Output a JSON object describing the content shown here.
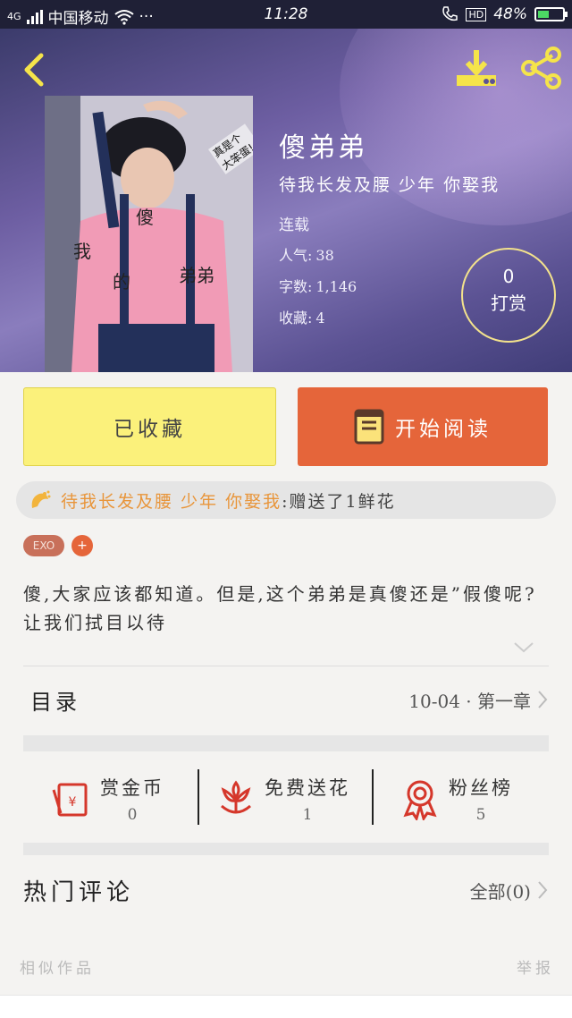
{
  "status_bar": {
    "network": "4G",
    "carrier": "中国移动",
    "dots": "···",
    "time": "11:28",
    "hd": "HD",
    "battery_text": "48%",
    "battery_level": 0.48,
    "battery_color": "#4cd964"
  },
  "header": {
    "back_icon": "chevron-left-icon",
    "download_icon": "download-icon",
    "share_icon": "share-icon",
    "icon_color": "#f5e44a"
  },
  "cover": {
    "text_1": "傻",
    "text_2": "我",
    "text_3": "的",
    "text_4": "弟弟",
    "note": "真是个大笨蛋!"
  },
  "book": {
    "title": "傻弟弟",
    "author": "待我长发及腰 少年 你娶我",
    "status": "连载",
    "popularity_label": "人气:",
    "popularity_value": "38",
    "words_label": "字数:",
    "words_value": "1,146",
    "favorites_label": "收藏:",
    "favorites_value": "4"
  },
  "tip": {
    "count": "0",
    "label": "打赏"
  },
  "actions": {
    "favorited_label": "已收藏",
    "read_label": "开始阅读",
    "read_icon": "book-icon"
  },
  "gift_banner": {
    "icon": "flower-icon",
    "user": "待我长发及腰 少年 你娶我",
    "text": ":赠送了1鲜花"
  },
  "tags": {
    "tag": "EXO",
    "add": "+"
  },
  "description": "傻,大家应该都知道。但是,这个弟弟是真傻还是”假傻呢?让我们拭目以待",
  "toc": {
    "label": "目录",
    "latest": "10-04 · 第一章"
  },
  "stats": {
    "coins_label": "赏金币",
    "coins_value": "0",
    "flowers_label": "免费送花",
    "flowers_value": "1",
    "fans_label": "粉丝榜",
    "fans_value": "5",
    "accent": "#d5372b"
  },
  "comments": {
    "label": "热门评论",
    "all": "全部(0)"
  },
  "footer": {
    "similar": "相似作品",
    "report": "举报"
  }
}
